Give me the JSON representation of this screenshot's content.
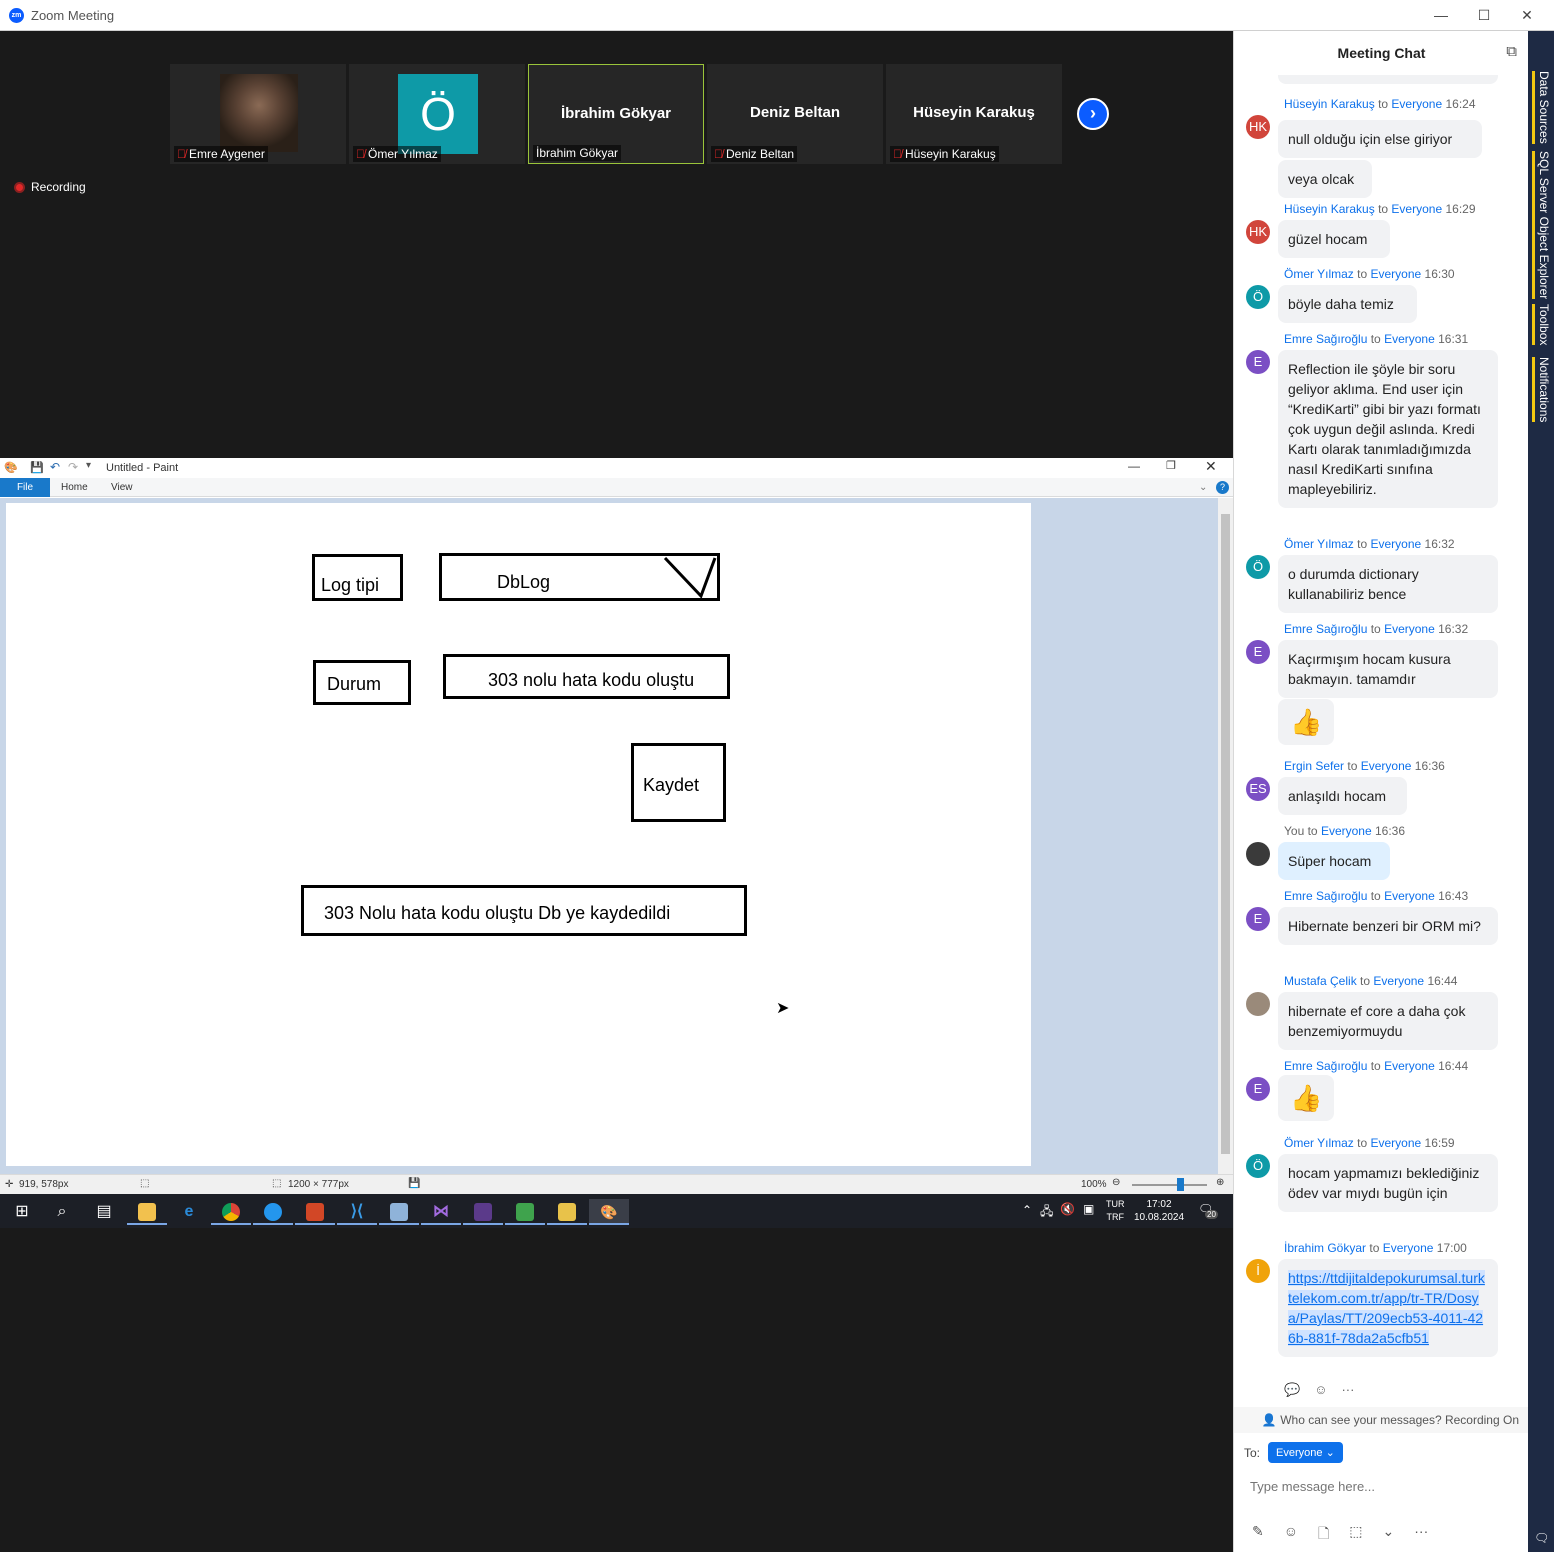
{
  "window": {
    "title": "Zoom Meeting",
    "app_logo": "zm"
  },
  "participants": [
    {
      "name": "Emre Aygener",
      "tile": "photo",
      "label": "Emre Aygener",
      "muted": true
    },
    {
      "name": "Ömer Yılmaz",
      "tile": "letter",
      "letter": "Ö",
      "label": "Ömer Yılmaz",
      "muted": true
    },
    {
      "name": "İbrahim Gökyar",
      "tile": "name",
      "label": "İbrahim Gökyar",
      "muted": false
    },
    {
      "name": "Deniz Beltan",
      "tile": "name",
      "label": "Deniz Beltan",
      "muted": true
    },
    {
      "name": "Hüseyin Karakuş",
      "tile": "name",
      "label": "Hüseyin Karakuş",
      "muted": true
    }
  ],
  "recording": {
    "label": "Recording"
  },
  "paint": {
    "title": "Untitled - Paint",
    "tabs": {
      "file": "File",
      "home": "Home",
      "view": "View"
    },
    "drawing": {
      "log_tipi": "Log tipi",
      "dblog": "DbLog",
      "durum": "Durum",
      "hata": "303 nolu hata kodu oluştu",
      "kaydet": "Kaydet",
      "result": "303 Nolu hata kodu oluştu Db ye kaydedildi"
    },
    "status": {
      "cursor": "919, 578px",
      "size": "1200 × 777px",
      "zoom": "100%",
      "zoom_level": 1.0
    }
  },
  "taskbar": {
    "lang1": "TUR",
    "lang2": "TRF",
    "time": "17:02",
    "date": "10.08.2024",
    "notif_count": "20"
  },
  "chat": {
    "title": "Meeting Chat",
    "to_word": "to",
    "messages": [
      {
        "sender": "Hüseyin Karakuş",
        "to": "Everyone",
        "time": "16:24",
        "avatar": "HK",
        "avatar_color": "#d1453b",
        "texts": [
          "null olduğu için else giriyor",
          "veya olcak"
        ]
      },
      {
        "sender": "Hüseyin Karakuş",
        "to": "Everyone",
        "time": "16:29",
        "avatar": "HK",
        "avatar_color": "#d1453b",
        "texts": [
          "güzel hocam"
        ]
      },
      {
        "sender": "Ömer Yılmaz",
        "to": "Everyone",
        "time": "16:30",
        "avatar": "Ö",
        "avatar_color": "#0e9aa7",
        "texts": [
          "böyle daha temiz"
        ]
      },
      {
        "sender": "Emre Sağıroğlu",
        "to": "Everyone",
        "time": "16:31",
        "avatar": "E",
        "avatar_color": "#7b4fc4",
        "texts": [
          "Reflection ile şöyle bir soru geliyor aklıma. End user için “KrediKarti” gibi bir yazı formatı çok uygun değil aslında. Kredi Kartı olarak tanımladığımızda nasıl KrediKarti sınıfına mapleyebiliriz."
        ]
      },
      {
        "sender": "Ömer Yılmaz",
        "to": "Everyone",
        "time": "16:32",
        "avatar": "Ö",
        "avatar_color": "#0e9aa7",
        "texts": [
          "o durumda dictionary kullanabiliriz bence"
        ]
      },
      {
        "sender": "Emre Sağıroğlu",
        "to": "Everyone",
        "time": "16:32",
        "avatar": "E",
        "avatar_color": "#7b4fc4",
        "texts": [
          "Kaçırmışım hocam kusura bakmayın. tamamdır",
          "👍"
        ]
      },
      {
        "sender": "Ergin Sefer",
        "to": "Everyone",
        "time": "16:36",
        "avatar": "ES",
        "avatar_color": "#7b4fc4",
        "texts": [
          "anlaşıldı hocam"
        ]
      },
      {
        "sender": "You",
        "to": "Everyone",
        "time": "16:36",
        "avatar": "",
        "avatar_color": "#3a3a3a",
        "texts": [
          "Süper hocam"
        ]
      },
      {
        "sender": "Emre Sağıroğlu",
        "to": "Everyone",
        "time": "16:43",
        "avatar": "E",
        "avatar_color": "#7b4fc4",
        "texts": [
          "Hibernate benzeri bir ORM mi?"
        ]
      },
      {
        "sender": "Mustafa Çelik",
        "to": "Everyone",
        "time": "16:44",
        "avatar": "",
        "avatar_color": "#9a8a7a",
        "texts": [
          "hibernate ef core a daha çok benzemiyormuydu"
        ]
      },
      {
        "sender": "Emre Sağıroğlu",
        "to": "Everyone",
        "time": "16:44",
        "avatar": "E",
        "avatar_color": "#7b4fc4",
        "texts": [
          "👍"
        ]
      },
      {
        "sender": "Ömer Yılmaz",
        "to": "Everyone",
        "time": "16:59",
        "avatar": "Ö",
        "avatar_color": "#0e9aa7",
        "texts": [
          "hocam yapmamızı beklediğiniz ödev var mıydı bugün için"
        ]
      },
      {
        "sender": "İbrahim Gökyar",
        "to": "Everyone",
        "time": "17:00",
        "avatar": "İ",
        "avatar_color": "#f0a30a",
        "texts": [
          "https://ttdijitaldepokurumsal.turktelekom.com.tr/app/tr-TR/Dosya/Paylas/TT/209ecb53-4011-426b-881f-78da2a5cfb51"
        ]
      }
    ],
    "privacy": "Who can see your messages? Recording On",
    "to_label": "To:",
    "to_value": "Everyone",
    "input_placeholder": "Type message here..."
  },
  "side_tabs": [
    "Data Sources",
    "SQL Server Object Explorer",
    "Toolbox",
    "Notifications"
  ]
}
